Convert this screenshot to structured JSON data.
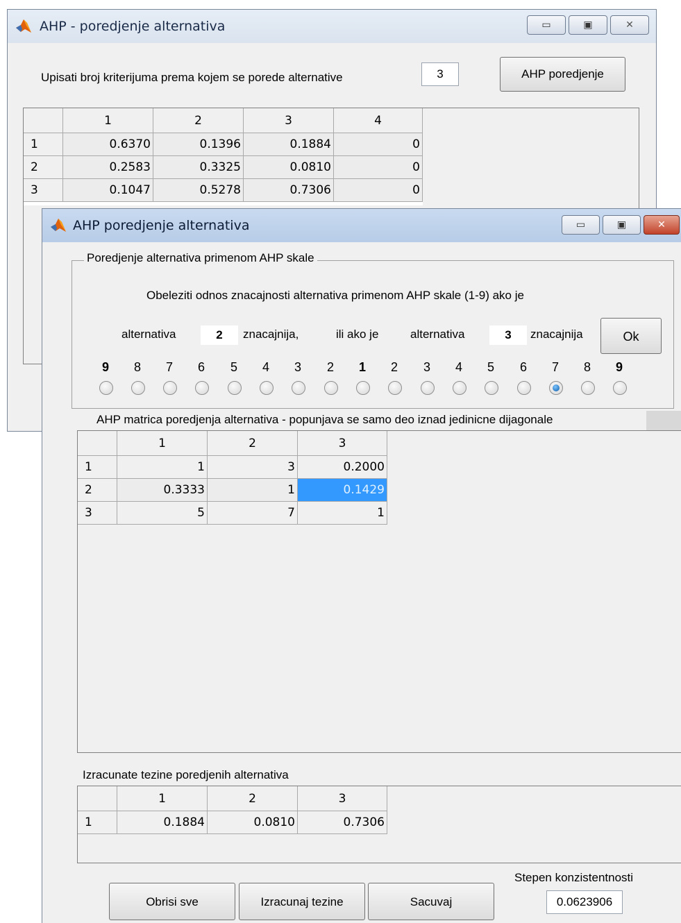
{
  "window1": {
    "title": "AHP - poredjenje alternativa",
    "criteria_label": "Upisati broj kriterijuma prema kojem se porede alternative",
    "criteria_value": "3",
    "compare_button": "AHP poredjenje",
    "table": {
      "columns": [
        "1",
        "2",
        "3",
        "4"
      ],
      "rows": [
        {
          "label": "1",
          "values": [
            "0.6370",
            "0.1396",
            "0.1884",
            "0"
          ]
        },
        {
          "label": "2",
          "values": [
            "0.2583",
            "0.3325",
            "0.0810",
            "0"
          ]
        },
        {
          "label": "3",
          "values": [
            "0.1047",
            "0.5278",
            "0.7306",
            "0"
          ]
        }
      ]
    }
  },
  "window2": {
    "title": "AHP poredjenje alternativa",
    "scale_panel": {
      "title": "Poredjenje alternativa primenom AHP skale",
      "instruction": "Obeleziti odnos znacajnosti alternativa primenom AHP skale (1-9) ako je",
      "alt_label_1": "alternativa",
      "alt_value_1": "2",
      "more_important_1": "znacajnija,",
      "or_if": "ili ako je",
      "alt_label_2": "alternativa",
      "alt_value_2": "3",
      "more_important_2": "znacajnija",
      "ok_button": "Ok",
      "scale": [
        "9",
        "8",
        "7",
        "6",
        "5",
        "4",
        "3",
        "2",
        "1",
        "2",
        "3",
        "4",
        "5",
        "6",
        "7",
        "8",
        "9"
      ],
      "selected_index": 14
    },
    "matrix_panel": {
      "title": "AHP matrica poredjenja alternativa - popunjava se samo deo iznad jedinicne dijagonale",
      "columns": [
        "1",
        "2",
        "3"
      ],
      "rows": [
        {
          "label": "1",
          "values": [
            "1",
            "3",
            "0.2000"
          ]
        },
        {
          "label": "2",
          "values": [
            "0.3333",
            "1",
            "0.1429"
          ]
        },
        {
          "label": "3",
          "values": [
            "5",
            "7",
            "1"
          ]
        }
      ]
    },
    "weights_panel": {
      "title": "Izracunate tezine poredjenih alternativa",
      "columns": [
        "1",
        "2",
        "3"
      ],
      "rows": [
        {
          "label": "1",
          "values": [
            "0.1884",
            "0.0810",
            "0.7306"
          ]
        }
      ]
    },
    "consistency": {
      "label": "Stepen konzistentnosti",
      "value": "0.0623906"
    },
    "buttons": {
      "clear": "Obrisi sve",
      "compute": "Izracunaj tezine",
      "save": "Sacuvaj"
    }
  }
}
